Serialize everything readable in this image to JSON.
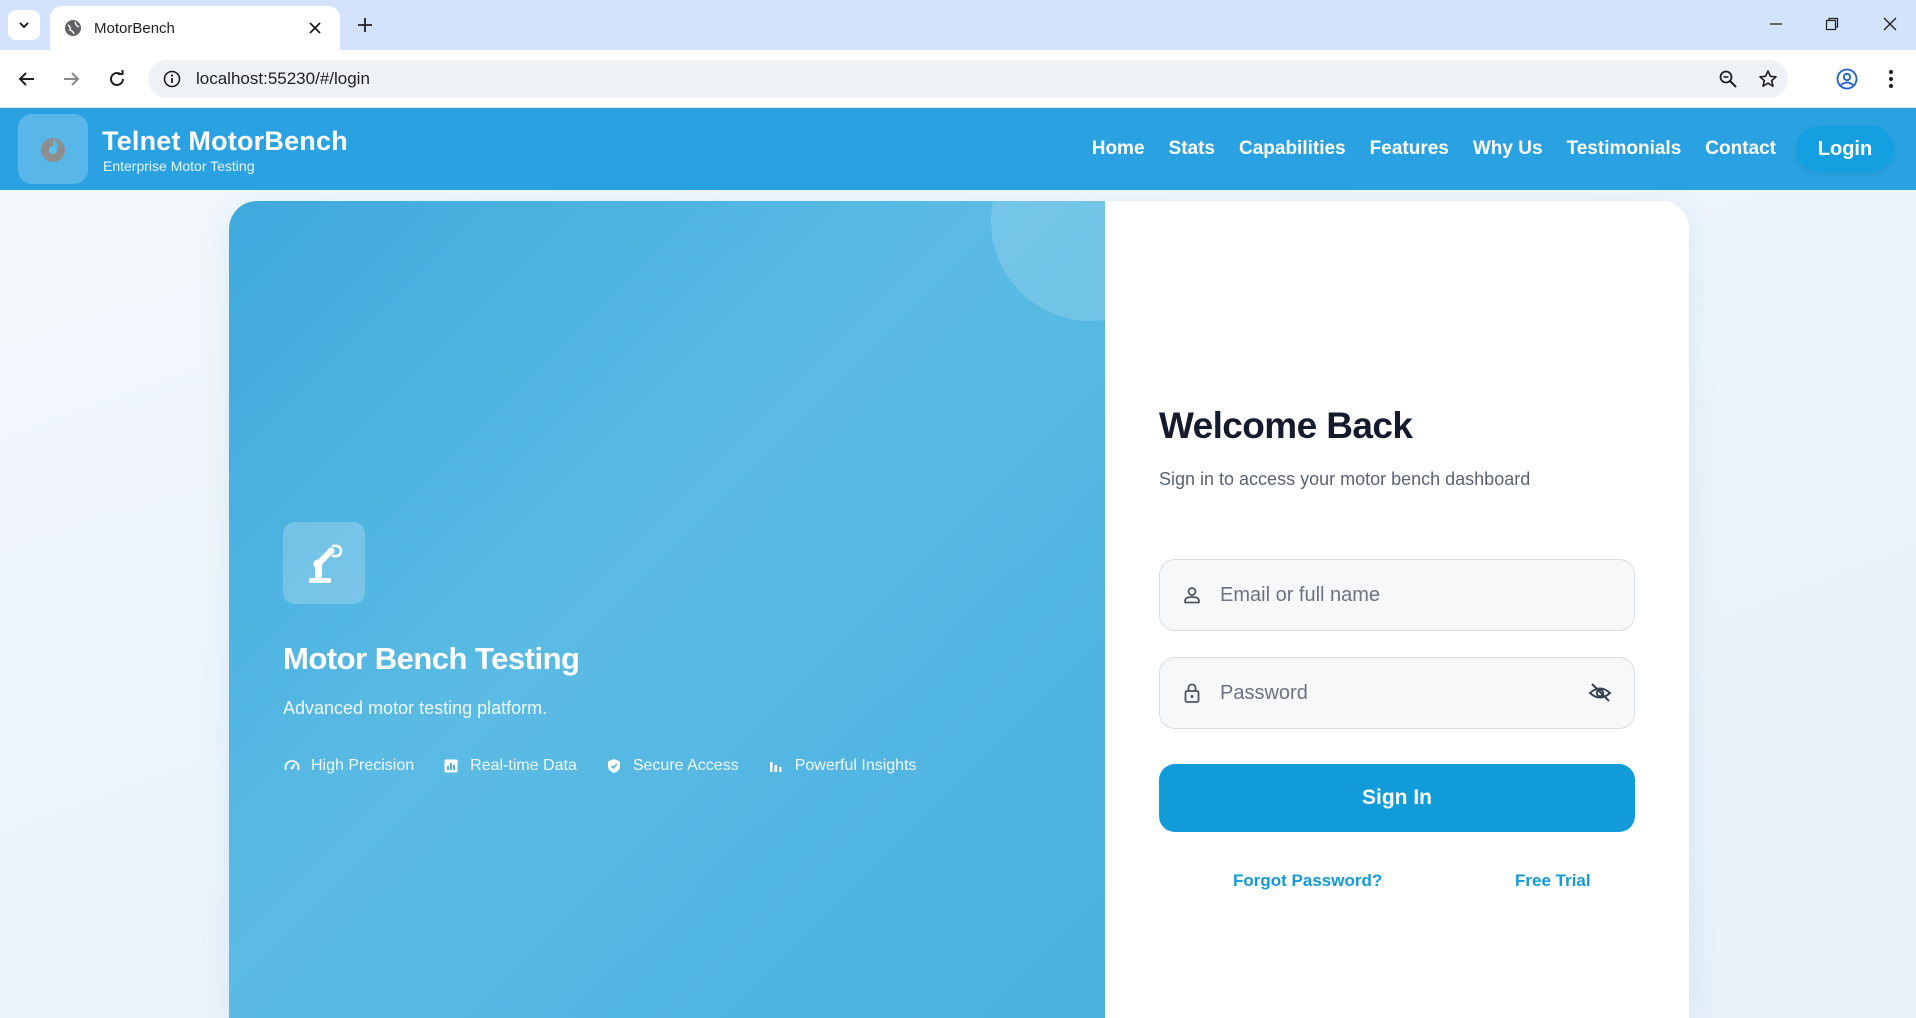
{
  "browser": {
    "tab_title": "MotorBench",
    "url": "localhost:55230/#/login"
  },
  "header": {
    "brand_title": "Telnet MotorBench",
    "brand_subtitle": "Enterprise Motor Testing",
    "nav": [
      "Home",
      "Stats",
      "Capabilities",
      "Features",
      "Why Us",
      "Testimonials",
      "Contact"
    ],
    "login_label": "Login"
  },
  "hero": {
    "title": "Motor Bench Testing",
    "subtitle": "Advanced motor testing platform.",
    "features": [
      {
        "label": "High Precision",
        "icon": "gauge-icon"
      },
      {
        "label": "Real-time Data",
        "icon": "chart-icon"
      },
      {
        "label": "Secure Access",
        "icon": "shield-icon"
      },
      {
        "label": "Powerful Insights",
        "icon": "bars-icon"
      }
    ]
  },
  "form": {
    "title": "Welcome Back",
    "subtitle": "Sign in to access your motor bench dashboard",
    "email_placeholder": "Email or full name",
    "password_placeholder": "Password",
    "signin_label": "Sign In",
    "forgot_label": "Forgot Password?",
    "trial_label": "Free Trial"
  },
  "colors": {
    "header_bg": "#2aa2e2",
    "primary": "#129bd9",
    "hero_gradient_start": "#3fa9dd",
    "hero_gradient_mid": "#5bbbe4",
    "title_text": "#151a2d"
  }
}
